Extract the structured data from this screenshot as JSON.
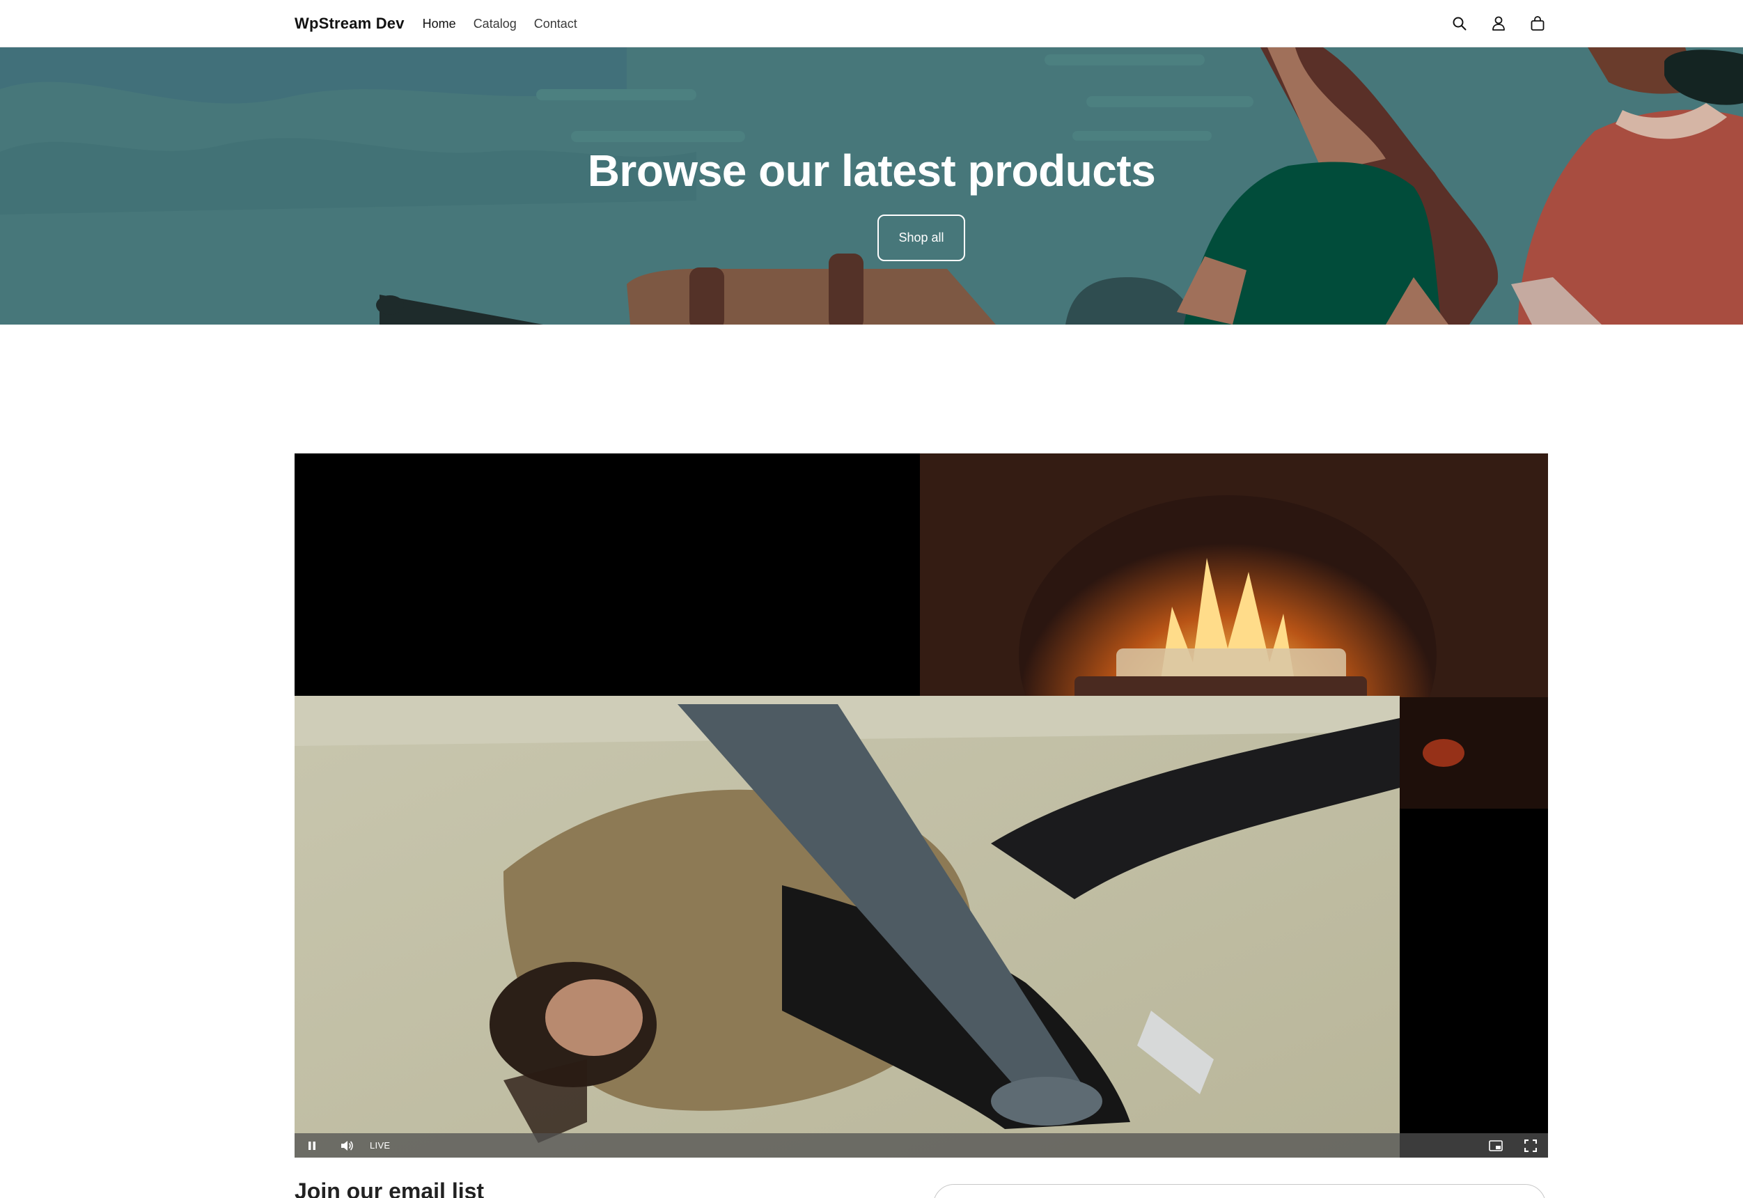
{
  "header": {
    "logo": "WpStream Dev",
    "nav": [
      {
        "label": "Home"
      },
      {
        "label": "Catalog"
      },
      {
        "label": "Contact"
      }
    ],
    "icons": [
      "search-icon",
      "account-icon",
      "cart-icon"
    ]
  },
  "hero": {
    "title": "Browse our latest products",
    "button_label": "Shop all",
    "colors": {
      "background": "#47777a",
      "text": "#ffffff"
    }
  },
  "video": {
    "live_label": "LIVE",
    "controls": [
      "pause-icon",
      "volume-icon",
      "picture-in-picture-icon",
      "fullscreen-icon"
    ]
  },
  "newsletter": {
    "title": "Join our email list"
  }
}
